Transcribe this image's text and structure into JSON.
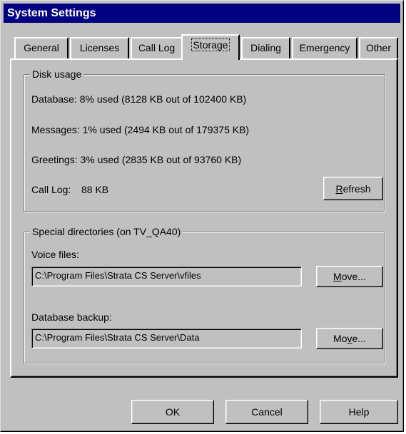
{
  "window": {
    "title": "System Settings"
  },
  "tabs": [
    {
      "label": "General"
    },
    {
      "label": "Licenses"
    },
    {
      "label": "Call Log"
    },
    {
      "label": "Storage",
      "active": true
    },
    {
      "label": "Dialing"
    },
    {
      "label": "Emergency"
    },
    {
      "label": "Other"
    }
  ],
  "disk_usage": {
    "title": "Disk usage",
    "database": "Database:  8% used (8128 KB out of 102400 KB)",
    "messages": "Messages: 1% used (2494 KB out of 179375 KB)",
    "greetings": "Greetings:  3% used (2835 KB out of 93760 KB)",
    "call_log_label": "Call Log:",
    "call_log_value": "88 KB",
    "refresh": {
      "mnemonic": "R",
      "rest": "efresh"
    }
  },
  "special_dirs": {
    "title": "Special directories (on TV_QA40)",
    "voice_files_label": "Voice files:",
    "voice_files_value": "C:\\Program Files\\Strata CS Server\\vfiles",
    "voice_move": {
      "before": "",
      "mnemonic": "M",
      "after": "ove..."
    },
    "db_backup_label": "Database backup:",
    "db_backup_value": "C:\\Program Files\\Strata CS Server\\Data",
    "db_move": {
      "before": "Mo",
      "mnemonic": "v",
      "after": "e..."
    }
  },
  "footer": {
    "ok": "OK",
    "cancel": "Cancel",
    "help": "Help"
  }
}
